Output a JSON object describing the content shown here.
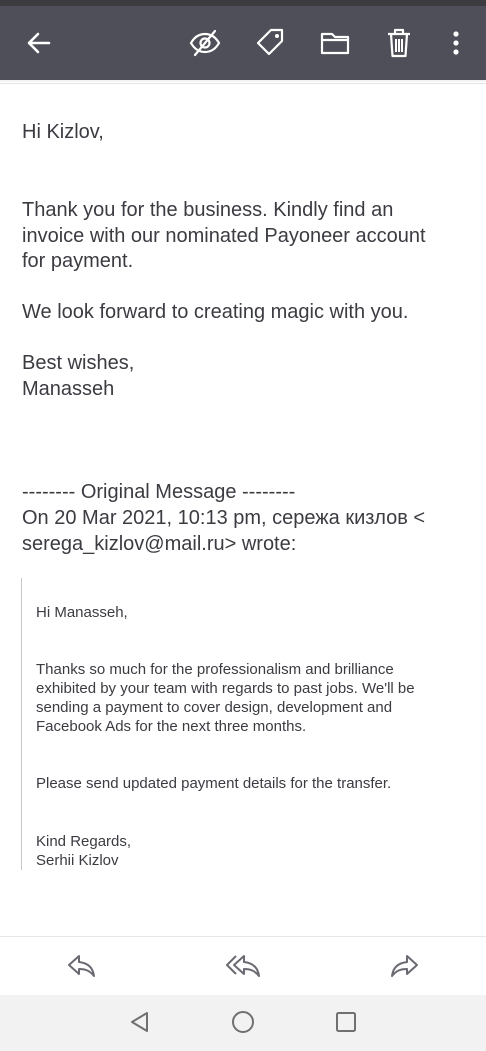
{
  "toolbar": {
    "back_icon": "arrow-left-icon",
    "icons": [
      "eye-off-icon",
      "tag-icon",
      "folder-icon",
      "trash-icon",
      "more-vertical-icon"
    ],
    "background": "#4f4f5a"
  },
  "message": {
    "greeting": "Hi Kizlov,",
    "para1_line1": "Thank you for the business. Kindly find an",
    "para1_line2": "invoice with our nominated Payoneer account",
    "para1_line3": "for payment.",
    "para2": "We look forward to creating magic with you.",
    "signoff": "Best wishes,",
    "signature": "Manasseh"
  },
  "original": {
    "header": "-------- Original Message --------",
    "meta_line1": "On 20 Mar 2021, 10:13 pm, сережа кизлов <",
    "meta_line2": "serega_kizlov@mail.ru> wrote:"
  },
  "quoted": {
    "greeting": "Hi Manasseh,",
    "para1_line1": "Thanks so much for the professionalism and brilliance",
    "para1_line2": "exhibited by your team with regards to past jobs. We'll be",
    "para1_line3": "sending a payment to cover design, development and",
    "para1_line4": "Facebook Ads for the next three months.",
    "para2": "Please send updated payment details for the transfer.",
    "signoff": "Kind Regards,",
    "signature": "Serhii Kizlov"
  },
  "actions": [
    "reply-icon",
    "reply-all-icon",
    "forward-icon"
  ],
  "navbar": [
    "nav-back-icon",
    "nav-home-icon",
    "nav-recents-icon"
  ]
}
